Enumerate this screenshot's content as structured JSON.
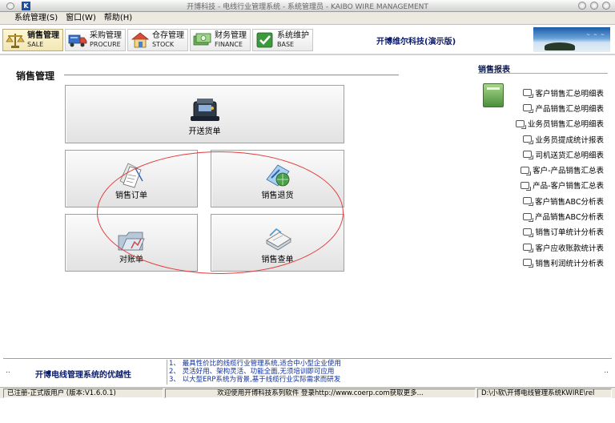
{
  "window": {
    "title": "开博科技 - 电线行业管理系统 - 系统管理员 - KAIBO WIRE MANAGEMENT",
    "app_icon": "K"
  },
  "menu": [
    {
      "label": "系统管理(S)"
    },
    {
      "label": "窗口(W)"
    },
    {
      "label": "帮助(H)"
    }
  ],
  "modules": [
    {
      "cn": "销售管理",
      "en": "SALE",
      "icon": "scale-icon",
      "active": true
    },
    {
      "cn": "采购管理",
      "en": "PROCURE",
      "icon": "truck-icon",
      "active": false
    },
    {
      "cn": "仓存管理",
      "en": "STOCK",
      "icon": "house-icon",
      "active": false
    },
    {
      "cn": "财务管理",
      "en": "FINANCE",
      "icon": "money-icon",
      "active": false
    },
    {
      "cn": "系统维护",
      "en": "BASE",
      "icon": "check-icon",
      "active": false
    }
  ],
  "company_name": "开博维尔科技(演示版)",
  "section_title": "销售管理",
  "functions": {
    "delivery": "开送货单",
    "sales_order": "销售订单",
    "sales_return": "销售退货",
    "statement": "对账单",
    "sales_query": "销售查单"
  },
  "reports": {
    "title": "销售报表",
    "items": [
      "客户销售汇总明细表",
      "产品销售汇总明细表",
      "业务员销售汇总明细表",
      "业务员提成统计报表",
      "司机送货汇总明细表",
      "客户-产品销售汇总表",
      "产品-客户销售汇总表",
      "客户销售ABC分析表",
      "产品销售ABC分析表",
      "销售订单统计分析表",
      "客户应收账款统计表",
      "销售利润统计分析表"
    ]
  },
  "info": {
    "title": "开博电线管理系统的优越性",
    "lines": [
      "1、 最具性价比的线缆行业管理系统,适合中小型企业使用",
      "2、 灵活好用、架构灵活、功能全面,无须培训即可应用",
      "3、 以大型ERP系统为背景,基于线缆行业实际需求而研发"
    ],
    "dots": ".."
  },
  "status": {
    "registration": "已注册-正式版用户 (版本:V1.6.0.1)",
    "welcome": "欢迎使用开博科技系列软件  登录http://www.coerp.com获取更多...",
    "path": "D:\\小软\\开博电线管理系统KWIRE\\rel"
  }
}
